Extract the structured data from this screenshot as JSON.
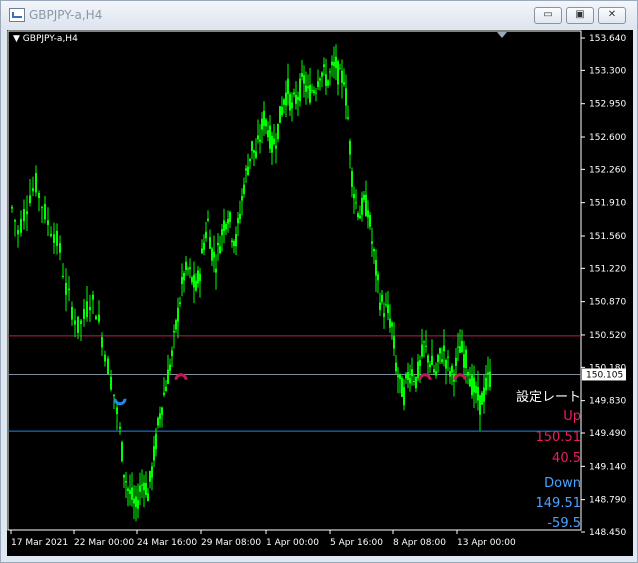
{
  "window": {
    "title": "GBPJPY-a,H4",
    "controls": {
      "minimize": "▭",
      "maximize": "▣",
      "close": "✕"
    }
  },
  "chart": {
    "symbol_label": "GBPJPY-a,H4",
    "current_price": "150.105",
    "price_ticks": [
      "153.640",
      "153.300",
      "152.950",
      "152.600",
      "152.260",
      "151.910",
      "151.560",
      "151.220",
      "150.870",
      "150.520",
      "150.180",
      "149.830",
      "149.490",
      "149.140",
      "148.790",
      "148.450"
    ],
    "time_ticks": [
      "17 Mar 2021",
      "22 Mar 00:00",
      "24 Mar 16:00",
      "29 Mar 08:00",
      "1 Apr 00:00",
      "5 Apr 16:00",
      "8 Apr 08:00",
      "13 Apr 00:00"
    ],
    "lines": {
      "up_line_price": 150.51,
      "down_line_price": 149.51,
      "current_line_price": 150.105,
      "up_color": "#c2185b",
      "down_color": "#1e88e5",
      "current_color": "#7f8f9f"
    },
    "candle_color": "#00ff00",
    "panel": {
      "title": "設定レート",
      "up_label": "Up",
      "up_value": "150.51",
      "up_diff": "40.5",
      "down_label": "Down",
      "down_value": "149.51",
      "down_diff": "-59.5",
      "title_color": "#ffffff",
      "up_color": "#e91e63",
      "down_color": "#4aa3ff"
    }
  }
}
